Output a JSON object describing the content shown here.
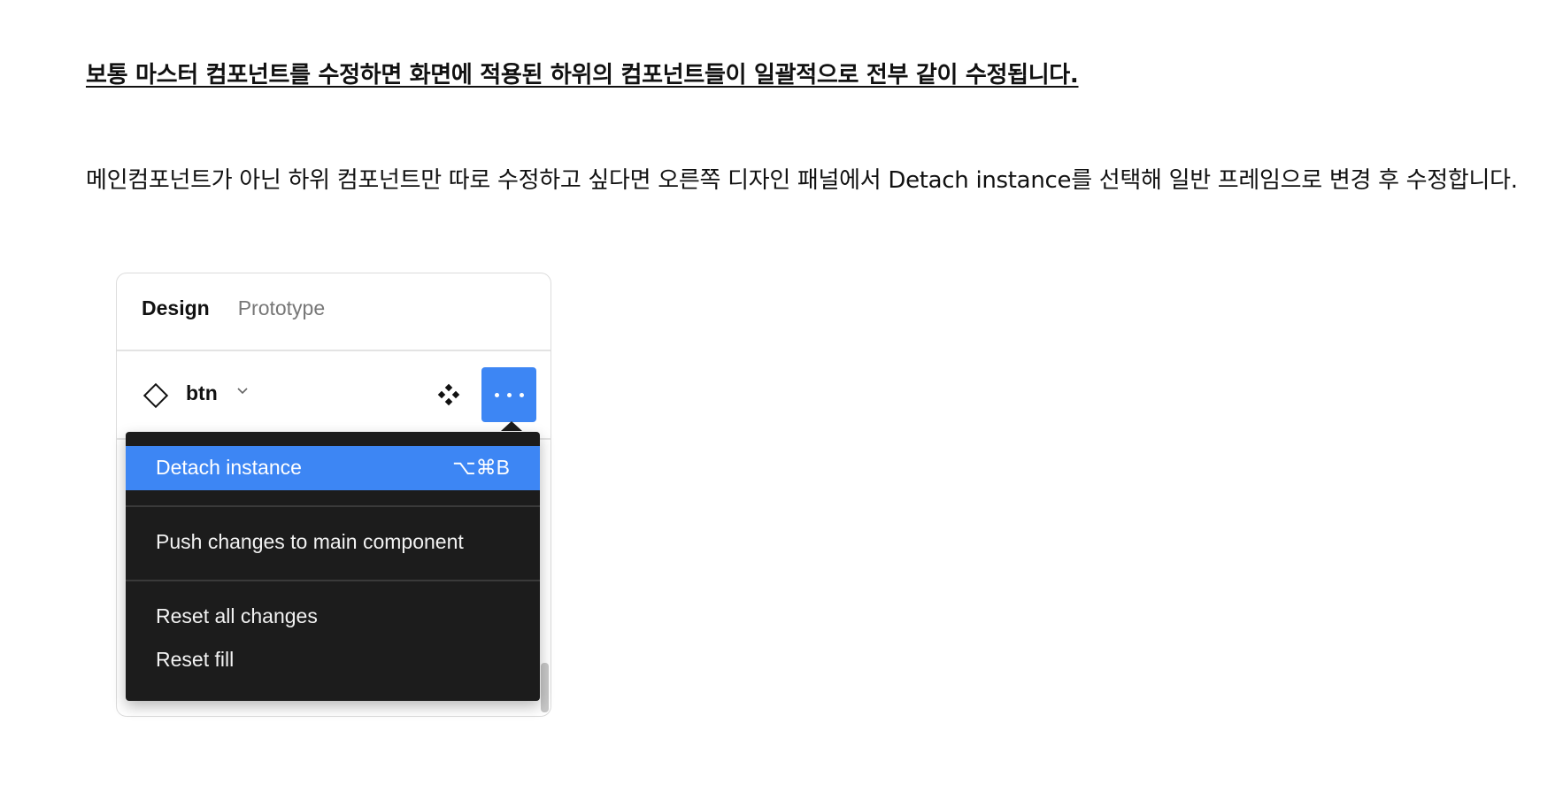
{
  "heading": "보통 마스터 컴포넌트를 수정하면 화면에 적용된 하위의 컴포넌트들이 일괄적으로 전부 같이 수정됩니다.",
  "paragraph": {
    "before": "메인컴포넌트가 아닌 하위 컴포넌트만 따로 수정하고 싶다면 오른쪽 디자인 패널에서 ",
    "strong": "Detach instance",
    "after": "를 선택해 일반 프레임으로 변경 후 수정합니다."
  },
  "panel": {
    "tabs": {
      "design": "Design",
      "prototype": "Prototype"
    },
    "component": {
      "name": "btn"
    },
    "icons": [
      "diamond-instance-icon",
      "chevron-down-icon",
      "component-set-icon",
      "more-icon"
    ],
    "accent_color": "#3d86f4",
    "menu_bg": "#1c1c1c"
  },
  "menu": {
    "detach": {
      "label": "Detach instance",
      "shortcut": "⌥⌘B"
    },
    "push": {
      "label": "Push changes to main component"
    },
    "reset_all": {
      "label": "Reset all changes"
    },
    "reset_fill": {
      "label": "Reset fill"
    }
  }
}
